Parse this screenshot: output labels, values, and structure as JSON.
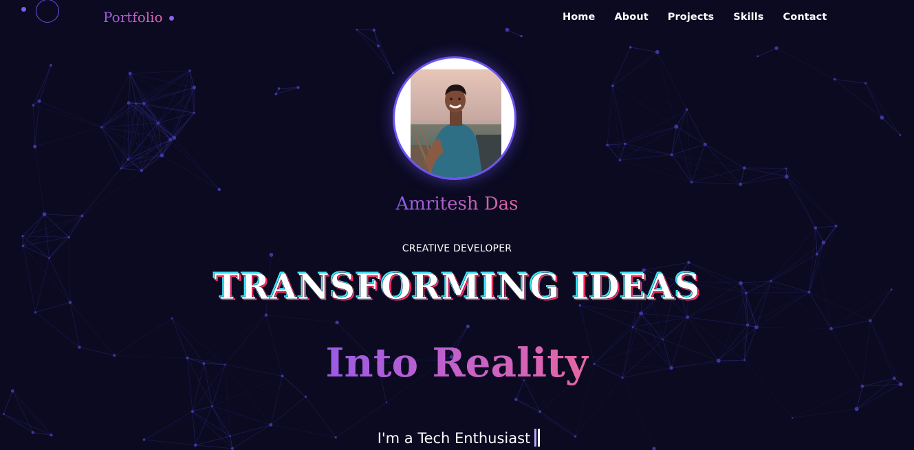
{
  "navbar": {
    "logo": "Portfolio",
    "links": [
      "Home",
      "About",
      "Projects",
      "Skills",
      "Contact"
    ]
  },
  "hero": {
    "name": "Amritesh Das",
    "role": "CREATIVE DEVELOPER",
    "headline": "TRANSFORMING IDEAS",
    "subheadline": "Into Reality",
    "typed_text": "I'm a Tech Enthusiast"
  },
  "icons": {
    "cursor": "cursor-follower-icon",
    "avatar": "profile-photo"
  },
  "colors": {
    "background": "#0b0a21",
    "accent": "#6d55f2",
    "gradient_start": "#9a5ce6",
    "gradient_end": "#e065a8",
    "network_line": "#2c2a7a"
  }
}
